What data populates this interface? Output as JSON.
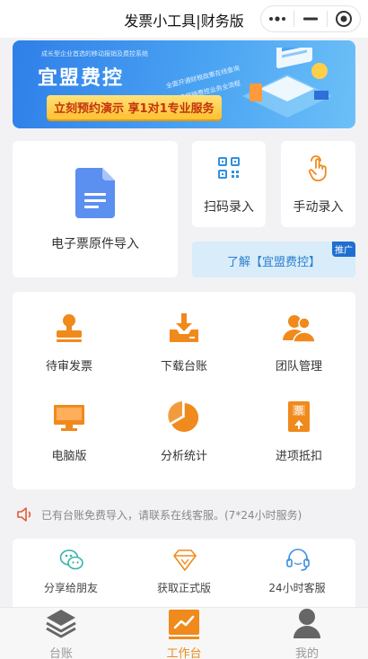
{
  "header": {
    "title": "发票小工具|财务版"
  },
  "banner": {
    "subtitle": "成长型企业首选的移动报销及费控系统",
    "brand": "宜盟费控",
    "tagline1": "全面开通财税政策在线查询",
    "tagline2": "打造报销费控业务全流程",
    "cta": "立刻预约演示 享1对1专业服务"
  },
  "entry": {
    "electronic_import": "电子票原件导入",
    "scan": "扫码录入",
    "manual": "手动录入",
    "promo_text": "了解【宜盟费控】",
    "promo_badge": "推广"
  },
  "functions": [
    {
      "label": "待审发票",
      "icon": "stamp-icon"
    },
    {
      "label": "下载台账",
      "icon": "download-icon"
    },
    {
      "label": "团队管理",
      "icon": "team-icon"
    },
    {
      "label": "电脑版",
      "icon": "monitor-icon"
    },
    {
      "label": "分析统计",
      "icon": "pie-chart-icon"
    },
    {
      "label": "进项抵扣",
      "icon": "ticket-icon"
    }
  ],
  "notice": {
    "text": "已有台账免费导入，请联系在线客服。(7*24小时服务)"
  },
  "services": [
    {
      "label": "分享给朋友",
      "icon": "wechat-icon"
    },
    {
      "label": "获取正式版",
      "icon": "diamond-icon"
    },
    {
      "label": "24小时客服",
      "icon": "headset-icon"
    }
  ],
  "tabs": [
    {
      "label": "台账",
      "icon": "layers-icon"
    },
    {
      "label": "工作台",
      "icon": "dashboard-icon",
      "active": true
    },
    {
      "label": "我的",
      "icon": "user-icon"
    }
  ],
  "colors": {
    "accent": "#f08a1c",
    "blue": "#2a7fd0",
    "banner": "#3a8fec"
  }
}
